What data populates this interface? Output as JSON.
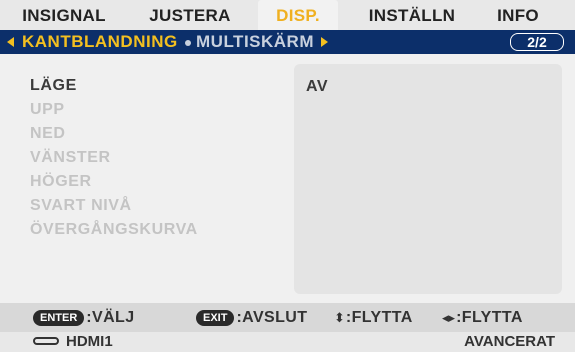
{
  "tabs": [
    {
      "label": "INSIGNAL",
      "active": false
    },
    {
      "label": "JUSTERA",
      "active": false
    },
    {
      "label": "DISP.",
      "active": true
    },
    {
      "label": "INSTÄLLN",
      "active": false
    },
    {
      "label": "INFO",
      "active": false
    }
  ],
  "subnav": {
    "active_label": "KANTBLANDNING",
    "inactive_label": "MULTISKÄRM",
    "page": "2/2"
  },
  "menu": {
    "items": [
      {
        "label": "LÄGE",
        "enabled": true
      },
      {
        "label": "UPP",
        "enabled": false
      },
      {
        "label": "NED",
        "enabled": false
      },
      {
        "label": "VÄNSTER",
        "enabled": false
      },
      {
        "label": "HÖGER",
        "enabled": false
      },
      {
        "label": "SVART NIVÅ",
        "enabled": false
      },
      {
        "label": "ÖVERGÅNGSKURVA",
        "enabled": false
      }
    ],
    "value": "AV"
  },
  "hints": {
    "enter_key": "ENTER",
    "enter_text": ":VÄLJ",
    "exit_key": "EXIT",
    "exit_text": ":AVSLUT",
    "updown_text": ":FLYTTA",
    "leftright_text": ":FLYTTA"
  },
  "status": {
    "source": "HDMI1",
    "mode": "AVANCERAT"
  },
  "colors": {
    "active_tab": "#f0b020",
    "subnav_bg": "#0c2f6a",
    "subnav_active": "#f4c020"
  }
}
